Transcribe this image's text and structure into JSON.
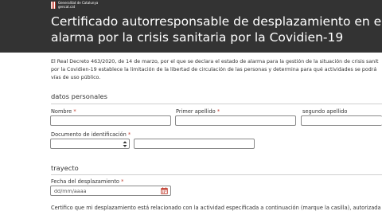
{
  "header": {
    "logo_line1": "Generalitat de Catalunya",
    "logo_line2": "gencat.cat",
    "title_line1": "Certificado autorresponsable de desplazamiento en el marco del es",
    "title_line2": "alarma por la crisis sanitaria por la Covidien-19"
  },
  "intro": {
    "line1": "El Real Decreto 463/2020, de 14 de marzo, por el que se declara el estado de alarma para la gestión de la situación de crisis sanit",
    "line2": "por la Covidien-19 establece la limitación de la libertad de circulación de las personas y determina para qué actividades se podrá",
    "line3": "vías de uso público."
  },
  "personal": {
    "section_title": "datos personales",
    "nombre_label": "Nombre",
    "nombre_value": "",
    "primer_apellido_label": "Primer apellido",
    "primer_apellido_value": "",
    "segundo_apellido_label": "segundo apellido",
    "segundo_apellido_value": "",
    "documento_label": "Documento de identificación",
    "documento_selected": "",
    "documento_number_value": ""
  },
  "trayecto": {
    "section_title": "trayecto",
    "fecha_label": "Fecha del desplazamiento",
    "fecha_placeholder": "dd/mm/aaaa"
  },
  "certifico": "Certifico que mi desplazamiento está relacionado con la actividad especificada a continuación (marque la casilla), autorizada p",
  "required_mark": "*",
  "icons": {
    "logo": "generalitat-logo-icon",
    "select": "select-arrows-icon",
    "calendar": "calendar-icon"
  },
  "colors": {
    "header_bg": "#333333",
    "required": "#c0392b",
    "calendar_icon": "#c0392b"
  }
}
